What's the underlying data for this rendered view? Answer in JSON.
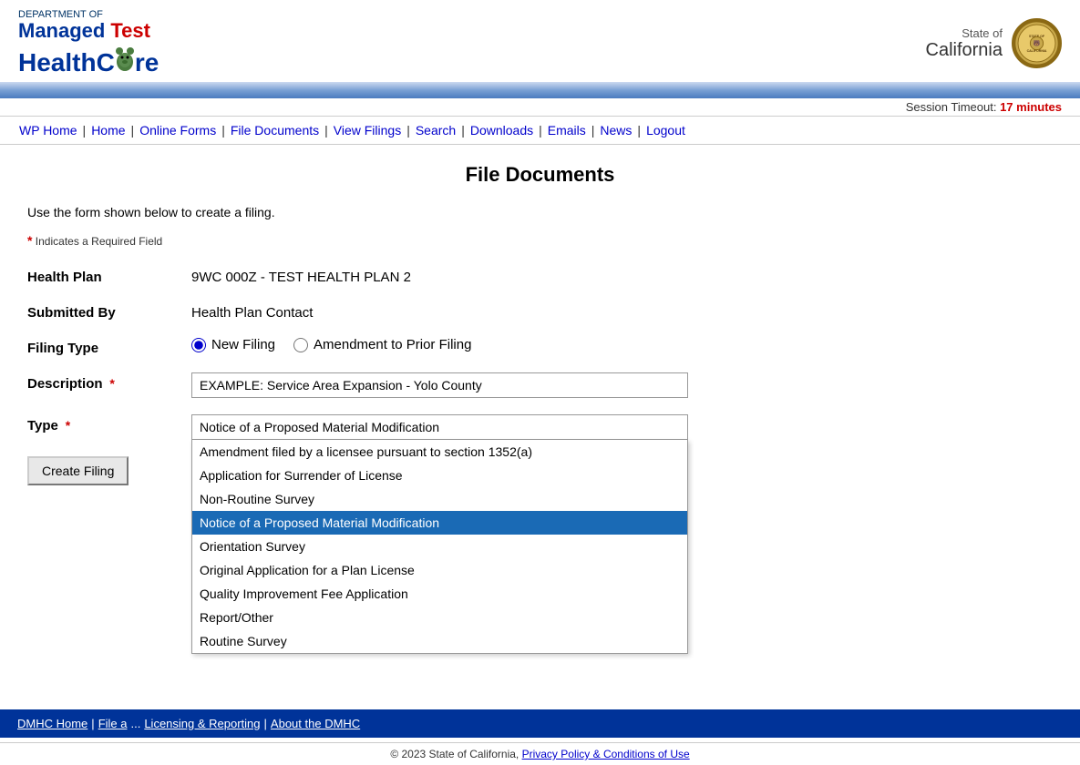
{
  "header": {
    "dept_line": "DEPARTMENT OF",
    "managed": "Managed",
    "test": "Test",
    "health": "Health",
    "care": "Care",
    "state_label": "State of",
    "california": "California"
  },
  "session": {
    "label": "Session Timeout:",
    "minutes": "17 minutes"
  },
  "nav": {
    "items": [
      {
        "label": "WP Home",
        "id": "wp-home"
      },
      {
        "label": "Home",
        "id": "home"
      },
      {
        "label": "Online Forms",
        "id": "online-forms"
      },
      {
        "label": "File Documents",
        "id": "file-documents"
      },
      {
        "label": "View Filings",
        "id": "view-filings"
      },
      {
        "label": "Search",
        "id": "search"
      },
      {
        "label": "Downloads",
        "id": "downloads"
      },
      {
        "label": "Emails",
        "id": "emails"
      },
      {
        "label": "News",
        "id": "news"
      },
      {
        "label": "Logout",
        "id": "logout"
      }
    ]
  },
  "page": {
    "title": "File Documents",
    "instruction": "Use the form shown below to create a filing.",
    "required_note": "Indicates a Required Field"
  },
  "form": {
    "health_plan_label": "Health Plan",
    "health_plan_value": "9WC 000Z - TEST HEALTH PLAN 2",
    "submitted_by_label": "Submitted By",
    "submitted_by_value": "Health Plan Contact",
    "filing_type_label": "Filing Type",
    "new_filing_label": "New Filing",
    "amendment_label": "Amendment to Prior Filing",
    "description_label": "Description",
    "description_placeholder": "EXAMPLE: Service Area Expansion - Yolo County",
    "type_label": "Type",
    "create_button": "Create Filing",
    "dropdown_selected": "Amendment filed by a licensee pursuant to section 1352(a)",
    "dropdown_options": [
      "Amendment filed by a licensee pursuant to section 1352(a)",
      "Application for Surrender of License",
      "Non-Routine Survey",
      "Notice of a Proposed Material Modification",
      "Orientation Survey",
      "Original Application for a Plan License",
      "Quality Improvement Fee Application",
      "Report/Other",
      "Routine Survey"
    ],
    "highlighted_option": "Notice of a Proposed Material Modification"
  },
  "footer": {
    "items": [
      {
        "label": "DMHC Home",
        "id": "dmhc-home"
      },
      {
        "label": "File a",
        "id": "file-a"
      },
      {
        "label": "Licensing & Reporting",
        "id": "licensing"
      },
      {
        "label": "About the DMHC",
        "id": "about"
      }
    ],
    "copyright": "© 2023 State of California,",
    "privacy_label": "Privacy Policy & Conditions of Use"
  }
}
